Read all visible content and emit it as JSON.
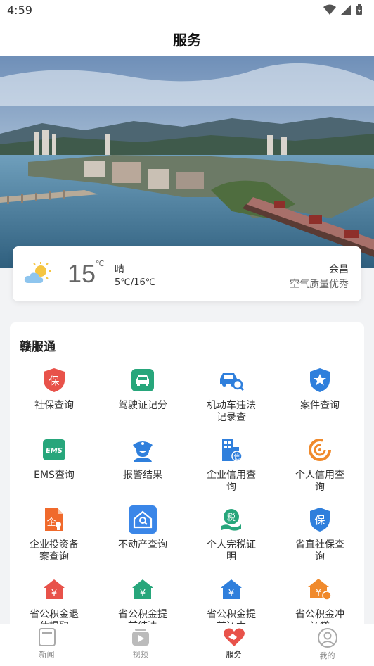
{
  "status": {
    "time": "4:59"
  },
  "header": {
    "title": "服务"
  },
  "weather": {
    "temperature": "15",
    "unit": "℃",
    "condition": "晴",
    "range": "5℃/16℃",
    "city": "会昌",
    "air_quality": "空气质量优秀"
  },
  "panel": {
    "title": "赣服通",
    "services": [
      {
        "label": "社保查询",
        "icon": "social-security-shield-icon",
        "color": "#e8524a"
      },
      {
        "label": "驾驶证记分",
        "icon": "car-license-icon",
        "color": "#27a67b"
      },
      {
        "label": "机动车违法记录查",
        "icon": "car-search-icon",
        "color": "#2f7fdc"
      },
      {
        "label": "案件查询",
        "icon": "police-badge-icon",
        "color": "#2f7fdc"
      },
      {
        "label": "EMS查询",
        "icon": "ems-icon",
        "color": "#27a67b"
      },
      {
        "label": "报警结果",
        "icon": "police-officer-icon",
        "color": "#2f7fdc"
      },
      {
        "label": "企业信用查询",
        "icon": "enterprise-credit-icon",
        "color": "#2f7fdc"
      },
      {
        "label": "个人信用查询",
        "icon": "personal-credit-icon",
        "color": "#f08a2c"
      },
      {
        "label": "企业投资备案查询",
        "icon": "investment-document-icon",
        "color": "#f06a2c"
      },
      {
        "label": "不动产查询",
        "icon": "real-estate-house-icon",
        "color": "#2f7fdc"
      },
      {
        "label": "个人完税证明",
        "icon": "tax-certificate-icon",
        "color": "#27a67b"
      },
      {
        "label": "省直社保查询",
        "icon": "provincial-social-security-icon",
        "color": "#2f7fdc"
      },
      {
        "label": "省公积金退休提取",
        "icon": "housing-fund-red-icon",
        "color": "#e8524a"
      },
      {
        "label": "省公积金提前结清",
        "icon": "housing-fund-green-icon",
        "color": "#27a67b"
      },
      {
        "label": "省公积金提前还本",
        "icon": "housing-fund-blue-icon",
        "color": "#2f7fdc"
      },
      {
        "label": "省公积金冲还贷",
        "icon": "housing-fund-orange-icon",
        "color": "#f08a2c"
      }
    ]
  },
  "tabs": [
    {
      "label": "新闻",
      "icon": "news-icon"
    },
    {
      "label": "视频",
      "icon": "video-icon"
    },
    {
      "label": "服务",
      "icon": "service-handshake-icon",
      "active": true,
      "color": "#e8524a"
    },
    {
      "label": "我的",
      "icon": "profile-icon"
    }
  ]
}
